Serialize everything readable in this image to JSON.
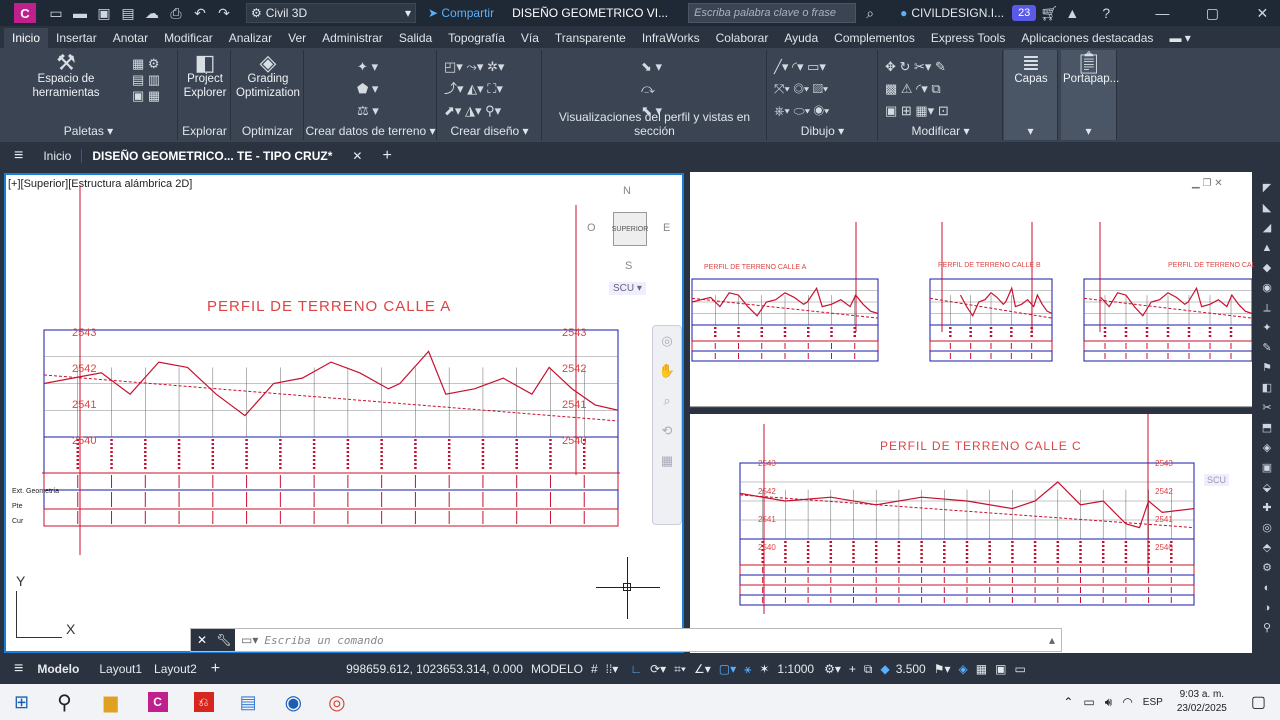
{
  "titlebar": {
    "app_logo": "C",
    "workspace": "Civil 3D",
    "share": "Compartir",
    "doc_title": "DISEÑO GEOMETRICO VI...",
    "search_placeholder": "Escriba palabra clave o frase",
    "user": "CIVILDESIGN.I...",
    "notifications": "23",
    "icons": [
      "new-icon",
      "open-icon",
      "save-icon",
      "saveas-icon",
      "cloud-icon",
      "print-icon",
      "undo-icon",
      "redo-icon",
      "gear-icon",
      "share-icon",
      "search-icon",
      "user-icon",
      "cart-icon",
      "tools-icon",
      "help-icon",
      "minimize-icon",
      "maximize-icon",
      "close-icon"
    ]
  },
  "ribbon_tabs": [
    "Inicio",
    "Insertar",
    "Anotar",
    "Modificar",
    "Analizar",
    "Ver",
    "Administrar",
    "Salida",
    "Topografía",
    "Vía",
    "Transparente",
    "InfraWorks",
    "Colaborar",
    "Ayuda",
    "Complementos",
    "Express Tools",
    "Aplicaciones destacadas"
  ],
  "ribbon": {
    "toolspace": "Espacio de herramientas",
    "project_explorer": "Project Explorer",
    "grading": "Grading Optimization",
    "capas": "Capas",
    "portapapeles": "Portapap...",
    "panels": {
      "paletas": "Paletas",
      "explorar": "Explorar",
      "optimizar": "Optimizar",
      "terreno": "Crear datos de terreno",
      "diseno": "Crear diseño",
      "visualizaciones": "Visualizaciones del perfil y vistas en sección",
      "dibujo": "Dibujo",
      "modificar": "Modificar"
    }
  },
  "doc_tabs": {
    "start": "Inicio",
    "active": "DISEÑO GEOMETRICO... TE - TIPO CRUZ*"
  },
  "viewport_left": {
    "label": "[+][Superior][Estructura alámbrica 2D]",
    "title": "PERFIL DE TERRENO CALLE A",
    "compass": {
      "n": "N",
      "s": "S",
      "e": "E",
      "o": "O",
      "center": "SUPERIOR",
      "ucs": "SCU"
    },
    "left_labels": [
      "2543",
      "2542",
      "2541",
      "2540"
    ],
    "right_labels": [
      "2543",
      "2542",
      "2541",
      "2540"
    ],
    "row_labels": [
      "Ext. Geometría",
      "Pte",
      "Cur"
    ],
    "axis_x": "X",
    "axis_y": "Y"
  },
  "viewport_right_top": {
    "titles": [
      "PERFIL DE TERRENO CALLE A",
      "PERFIL DE TERRENO CALLE B",
      "PERFIL DE TERRENO CALLE"
    ]
  },
  "viewport_right_bottom": {
    "title": "PERFIL DE TERRENO CALLE C",
    "left_labels": [
      "2543",
      "2542",
      "2541",
      "2540"
    ],
    "right_labels": [
      "2543",
      "2542",
      "2541",
      "2540"
    ],
    "ucs": "SCU"
  },
  "command": {
    "placeholder": "Escriba un comando"
  },
  "status": {
    "tabs": [
      "Modelo",
      "Layout1",
      "Layout2"
    ],
    "coords": "998659.612, 1023653.314, 0.000",
    "mode": "MODELO",
    "scale": "1:1000",
    "value": "3.500"
  },
  "taskbar": {
    "lang": "ESP",
    "time": "9:03 a. m.",
    "date": "23/02/2025"
  },
  "colors": {
    "profile": "#c8102e",
    "grid": "#1a1aa8",
    "accent": "#1a7fdb"
  }
}
